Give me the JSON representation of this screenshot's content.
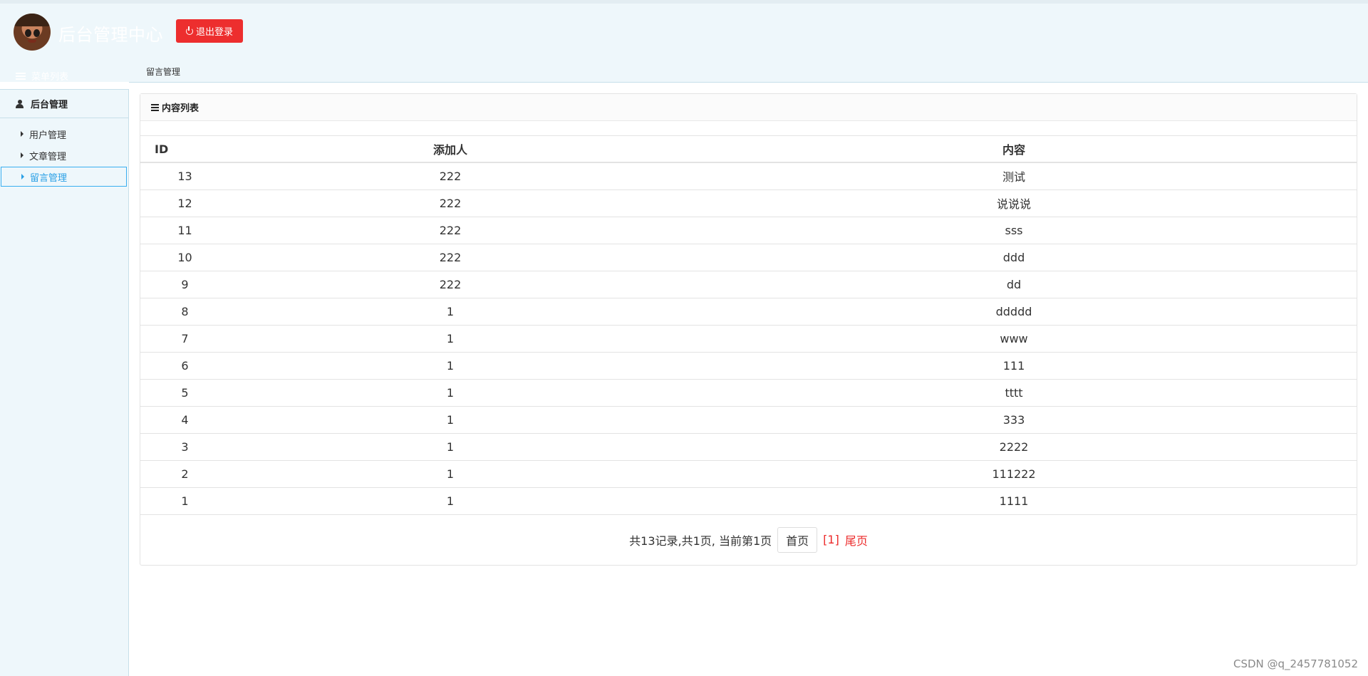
{
  "header": {
    "site_title": "后台管理中心",
    "logout_label": "退出登录",
    "menu_title": "菜单列表",
    "breadcrumb": "留言管理"
  },
  "sidebar": {
    "group_label": "后台管理",
    "items": [
      {
        "label": "用户管理",
        "active": false
      },
      {
        "label": "文章管理",
        "active": false
      },
      {
        "label": "留言管理",
        "active": true
      }
    ]
  },
  "panel": {
    "title": "内容列表",
    "columns": [
      "ID",
      "添加人",
      "内容"
    ],
    "rows": [
      [
        "13",
        "222",
        "测试"
      ],
      [
        "12",
        "222",
        "说说说"
      ],
      [
        "11",
        "222",
        "sss"
      ],
      [
        "10",
        "222",
        "ddd"
      ],
      [
        "9",
        "222",
        "dd"
      ],
      [
        "8",
        "1",
        "ddddd"
      ],
      [
        "7",
        "1",
        "www"
      ],
      [
        "6",
        "1",
        "111"
      ],
      [
        "5",
        "1",
        "tttt"
      ],
      [
        "4",
        "1",
        "333"
      ],
      [
        "3",
        "1",
        "2222"
      ],
      [
        "2",
        "1",
        "111222"
      ],
      [
        "1",
        "1",
        "1111"
      ]
    ]
  },
  "pagination": {
    "summary": "共13记录,共1页, 当前第1页",
    "first_label": "首页",
    "current_label": "[1]",
    "last_label": "尾页"
  },
  "watermark": "CSDN @q_2457781052",
  "colors": {
    "header_bg": "#eef7fb",
    "logout_red": "#ed2e2e",
    "active_blue": "#2aa0e6",
    "pager_red": "#ec2a2a"
  }
}
